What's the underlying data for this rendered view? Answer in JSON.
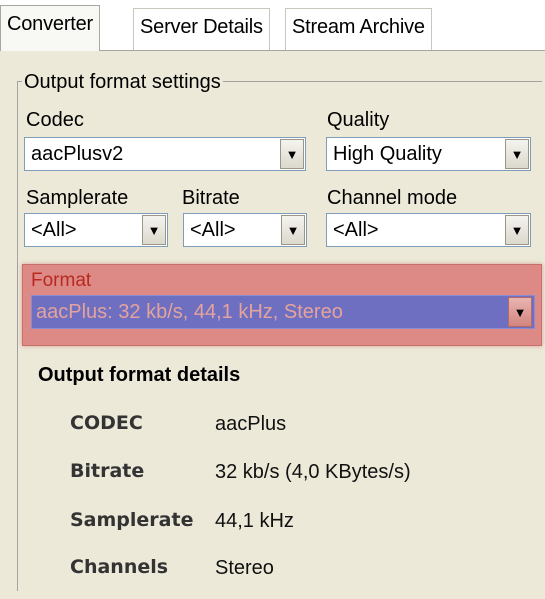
{
  "tabs": [
    {
      "label": "Converter"
    },
    {
      "label": "Server Details"
    },
    {
      "label": "Stream Archive"
    }
  ],
  "group": {
    "legend": "Output format settings"
  },
  "codec": {
    "label": "Codec",
    "value": "aacPlusv2"
  },
  "quality": {
    "label": "Quality",
    "value": "High Quality"
  },
  "samplerate": {
    "label": "Samplerate",
    "value": "<All>"
  },
  "bitrate": {
    "label": "Bitrate",
    "value": "<All>"
  },
  "channel_mode": {
    "label": "Channel mode",
    "value": "<All>"
  },
  "format": {
    "label": "Format",
    "value": "aacPlus: 32 kb/s, 44,1 kHz, Stereo",
    "highlight_color": "#dd8a86"
  },
  "details": {
    "title": "Output format details",
    "rows": [
      {
        "key": "CODEC",
        "value": "aacPlus"
      },
      {
        "key": "Bitrate",
        "value": "32 kb/s (4,0 KBytes/s)"
      },
      {
        "key": "Samplerate",
        "value": "44,1 kHz"
      },
      {
        "key": "Channels",
        "value": "Stereo"
      }
    ]
  },
  "icons": {
    "dropdown": "chevron-down-icon"
  }
}
